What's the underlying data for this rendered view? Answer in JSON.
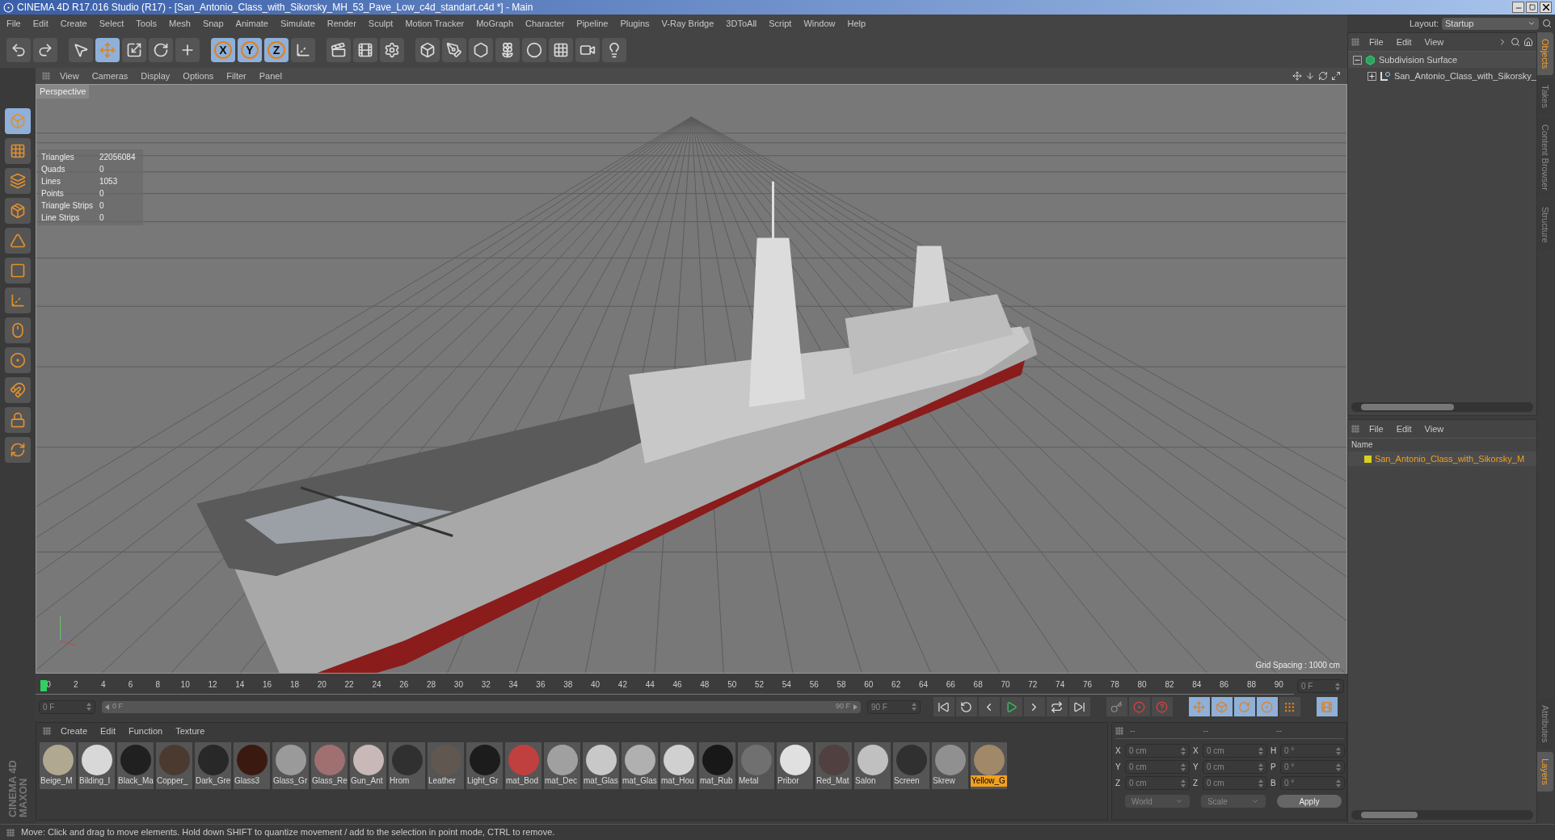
{
  "window": {
    "title": "CINEMA 4D R17.016 Studio (R17) - [San_Antonio_Class_with_Sikorsky_MH_53_Pave_Low_c4d_standart.c4d *] - Main"
  },
  "menu_bar": [
    "File",
    "Edit",
    "Create",
    "Select",
    "Tools",
    "Mesh",
    "Snap",
    "Animate",
    "Simulate",
    "Render",
    "Sculpt",
    "Motion Tracker",
    "MoGraph",
    "Character",
    "Pipeline",
    "Plugins",
    "V-Ray Bridge",
    "3DToAll",
    "Script",
    "Window",
    "Help"
  ],
  "layout": {
    "label": "Layout:",
    "value": "Startup"
  },
  "toolbar": [
    {
      "kind": "undo",
      "selected": false
    },
    {
      "kind": "redo",
      "selected": false
    },
    {
      "kind": "select",
      "selected": false
    },
    {
      "kind": "move",
      "selected": true
    },
    {
      "kind": "scale",
      "selected": false
    },
    {
      "kind": "rotate",
      "selected": false
    },
    {
      "kind": "add",
      "selected": false
    },
    {
      "kind": "axis",
      "label": "X",
      "selected": true
    },
    {
      "kind": "axis",
      "label": "Y",
      "selected": true
    },
    {
      "kind": "axis",
      "label": "Z",
      "selected": true
    },
    {
      "kind": "coord",
      "selected": false
    },
    {
      "kind": "render-view",
      "selected": false
    },
    {
      "kind": "render",
      "selected": false
    },
    {
      "kind": "render-settings",
      "selected": false
    },
    {
      "kind": "cube",
      "selected": false
    },
    {
      "kind": "pen",
      "selected": false
    },
    {
      "kind": "subdiv",
      "selected": false
    },
    {
      "kind": "cloner",
      "selected": false
    },
    {
      "kind": "deformer",
      "selected": false
    },
    {
      "kind": "floor",
      "selected": false
    },
    {
      "kind": "camera",
      "selected": false
    },
    {
      "kind": "light",
      "selected": false
    }
  ],
  "left_toolbar": [
    {
      "kind": "model",
      "selected": true
    },
    {
      "kind": "texture",
      "selected": false
    },
    {
      "kind": "workplane",
      "selected": false
    },
    {
      "kind": "points",
      "selected": false
    },
    {
      "kind": "edges",
      "selected": false
    },
    {
      "kind": "polygons",
      "selected": false
    },
    {
      "kind": "axis",
      "selected": false
    },
    {
      "kind": "tweak",
      "selected": false
    },
    {
      "kind": "snap",
      "selected": false
    },
    {
      "kind": "magnet",
      "selected": false
    },
    {
      "kind": "grid-lock",
      "selected": false
    },
    {
      "kind": "grid-rotate",
      "selected": false
    }
  ],
  "viewport": {
    "menu": [
      "View",
      "Cameras",
      "Display",
      "Options",
      "Filter",
      "Panel"
    ],
    "camera": "Perspective",
    "stats": [
      {
        "label": "Triangles",
        "value": "22056084"
      },
      {
        "label": "Quads",
        "value": "0"
      },
      {
        "label": "Lines",
        "value": "1053"
      },
      {
        "label": "Points",
        "value": "0"
      },
      {
        "label": "Triangle Strips",
        "value": "0"
      },
      {
        "label": "Line Strips",
        "value": "0"
      }
    ],
    "grid_spacing": "Grid Spacing : 1000 cm"
  },
  "timeline": {
    "ticks": [
      "0",
      "2",
      "4",
      "6",
      "8",
      "10",
      "12",
      "14",
      "16",
      "18",
      "20",
      "22",
      "24",
      "26",
      "28",
      "30",
      "32",
      "34",
      "36",
      "38",
      "40",
      "42",
      "44",
      "46",
      "48",
      "50",
      "52",
      "54",
      "56",
      "58",
      "60",
      "62",
      "64",
      "66",
      "68",
      "70",
      "72",
      "74",
      "76",
      "78",
      "80",
      "82",
      "84",
      "86",
      "88",
      "90"
    ],
    "current_frame": "0 F",
    "start": "0 F",
    "range": {
      "start": "0 F",
      "end": "90 F",
      "level": 1
    },
    "end": "90 F"
  },
  "materials": {
    "menu": [
      "Create",
      "Edit",
      "Function",
      "Texture"
    ],
    "items": [
      {
        "name": "Beige_M",
        "color": "#b0a890",
        "selected": false
      },
      {
        "name": "Bilding_I",
        "color": "#d8d8d8",
        "selected": false
      },
      {
        "name": "Black_Ma",
        "color": "#202020",
        "selected": false
      },
      {
        "name": "Copper_",
        "color": "#4a3a30",
        "selected": false
      },
      {
        "name": "Dark_Gre",
        "color": "#282828",
        "selected": false
      },
      {
        "name": "Glass3",
        "color": "#3a1a10",
        "selected": false
      },
      {
        "name": "Glass_Gr",
        "color": "#9a9a9a",
        "selected": false
      },
      {
        "name": "Glass_Re",
        "color": "#a07070",
        "selected": false
      },
      {
        "name": "Gun_Ant",
        "color": "#c8b8b8",
        "selected": false
      },
      {
        "name": "Hrom",
        "color": "#303030",
        "selected": false
      },
      {
        "name": "Leather",
        "color": "#605850",
        "selected": false
      },
      {
        "name": "Light_Gr",
        "color": "#1c1c1c",
        "selected": false
      },
      {
        "name": "mat_Bod",
        "color": "#c04040",
        "selected": false
      },
      {
        "name": "mat_Dec",
        "color": "#a0a0a0",
        "selected": false
      },
      {
        "name": "mat_Glas",
        "color": "#c8c8c8",
        "selected": false
      },
      {
        "name": "mat_Glas",
        "color": "#b0b0b0",
        "selected": false
      },
      {
        "name": "mat_Hou",
        "color": "#d0d0d0",
        "selected": false
      },
      {
        "name": "mat_Rub",
        "color": "#181818",
        "selected": false
      },
      {
        "name": "Metal",
        "color": "#707070",
        "selected": false
      },
      {
        "name": "Pribor",
        "color": "#e0e0e0",
        "selected": false
      },
      {
        "name": "Red_Mat",
        "color": "#504040",
        "selected": false
      },
      {
        "name": "Salon",
        "color": "#c0c0c0",
        "selected": false
      },
      {
        "name": "Screen",
        "color": "#303030",
        "selected": false
      },
      {
        "name": "Skrew",
        "color": "#909090",
        "selected": false
      },
      {
        "name": "Yellow_G",
        "color": "#a08868",
        "selected": true
      }
    ]
  },
  "coordinates": {
    "headers": [
      "--",
      "--",
      "--"
    ],
    "rows": [
      [
        {
          "label": "X",
          "value": "0 cm"
        },
        {
          "label": "X",
          "value": "0 cm"
        },
        {
          "label": "H",
          "value": "0 °"
        }
      ],
      [
        {
          "label": "Y",
          "value": "0 cm"
        },
        {
          "label": "Y",
          "value": "0 cm"
        },
        {
          "label": "P",
          "value": "0 °"
        }
      ],
      [
        {
          "label": "Z",
          "value": "0 cm"
        },
        {
          "label": "Z",
          "value": "0 cm"
        },
        {
          "label": "B",
          "value": "0 °"
        }
      ]
    ],
    "modes": [
      "World",
      "Scale"
    ],
    "apply": "Apply"
  },
  "objects_panel": {
    "menu": [
      "File",
      "Edit",
      "View"
    ],
    "tree": [
      {
        "name": "Subdivision Surface",
        "expanded": true,
        "children": [
          {
            "name": "San_Antonio_Class_with_Sikorsky_",
            "expanded": false
          }
        ]
      }
    ]
  },
  "side_tabs_top": [
    {
      "label": "Objects",
      "selected": true
    },
    {
      "label": "Takes",
      "selected": false
    },
    {
      "label": "Content Browser",
      "selected": false
    },
    {
      "label": "Structure",
      "selected": false
    }
  ],
  "layers_panel": {
    "menu": [
      "File",
      "Edit",
      "View"
    ],
    "column": "Name",
    "items": [
      {
        "name": "San_Antonio_Class_with_Sikorsky_M",
        "color": "#d8d020"
      }
    ]
  },
  "side_tabs_bottom": [
    {
      "label": "Attributes",
      "selected": false
    },
    {
      "label": "Layers",
      "selected": true
    }
  ],
  "logo": [
    "MAXON",
    "CINEMA 4D"
  ],
  "status_bar": "Move: Click and drag to move elements. Hold down SHIFT to quantize movement / add to the selection in point mode, CTRL to remove."
}
